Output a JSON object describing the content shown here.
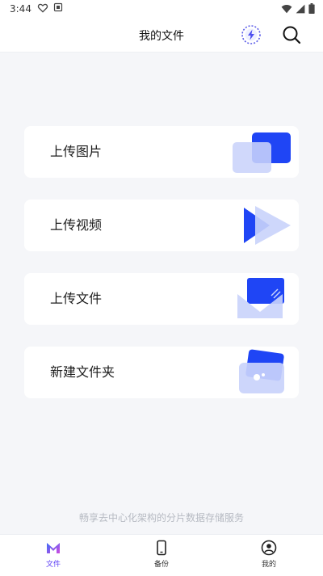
{
  "status_bar": {
    "time": "3:44",
    "left_icons": [
      "heart-outline-icon",
      "image-notification-icon"
    ],
    "right_icons": [
      "wifi-icon",
      "signal-icon",
      "battery-icon"
    ]
  },
  "header": {
    "title": "我的文件",
    "actions": [
      "bolt-icon",
      "search-icon"
    ]
  },
  "cards": [
    {
      "label": "上传图片",
      "icon": "upload-image-icon"
    },
    {
      "label": "上传视频",
      "icon": "upload-video-icon"
    },
    {
      "label": "上传文件",
      "icon": "upload-file-icon"
    },
    {
      "label": "新建文件夹",
      "icon": "new-folder-icon"
    }
  ],
  "footer_text": "畅享去中心化架构的分片数据存储服务",
  "tabbar": {
    "tabs": [
      {
        "label": "文件",
        "icon": "files-logo-icon",
        "active": true
      },
      {
        "label": "备份",
        "icon": "phone-backup-icon",
        "active": false
      },
      {
        "label": "我的",
        "icon": "user-profile-icon",
        "active": false
      }
    ]
  },
  "colors": {
    "accent": "#1f45f5",
    "accent_light": "#c9d3fb",
    "active_tab": "#5b3df5",
    "background": "#f5f6f9"
  }
}
